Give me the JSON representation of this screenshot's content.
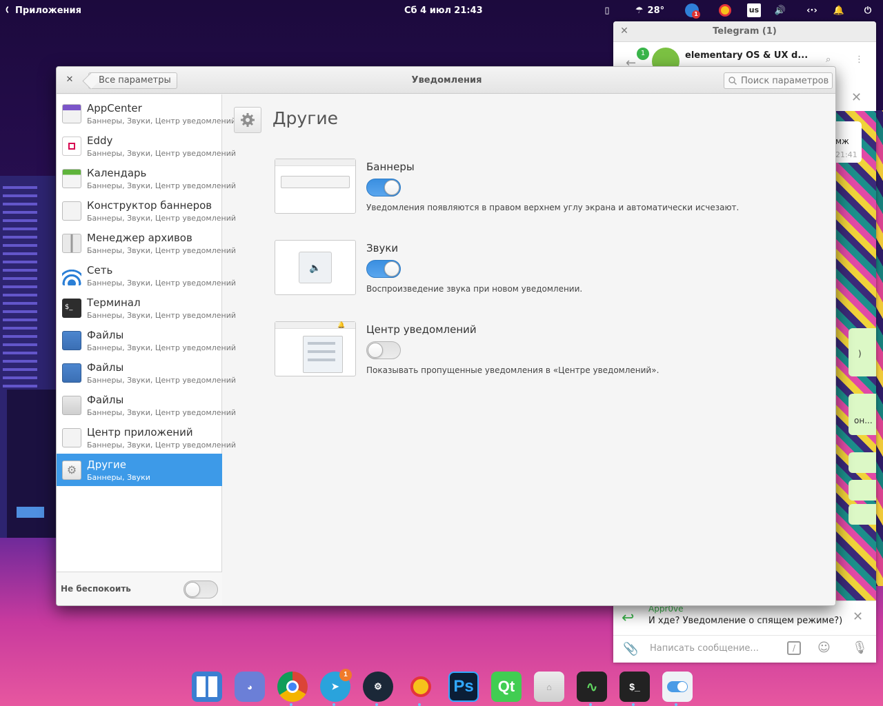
{
  "top_panel": {
    "apps_label": "Приложения",
    "date": "Сб  4 июл",
    "time": "21:43",
    "weather_temp": "28°",
    "keyboard_layout": "us",
    "tray_badge": "1"
  },
  "telegram": {
    "title": "Telegram (1)",
    "chat_name": "elementary OS & UX d...",
    "unread_badge": "1",
    "preview_snip": "мж",
    "preview_time": "21:41",
    "snip_2": ")",
    "snip_3": "он...",
    "notif_sender": "Appr0ve",
    "notif_text": "И хде? Уведомление о спящем режиме?)",
    "input_placeholder": "Написать сообщение..."
  },
  "settings": {
    "back_label": "Все параметры",
    "window_title": "Уведомления",
    "search_placeholder": "Поиск параметров",
    "sidebar": {
      "items": [
        {
          "name": "AppCenter",
          "sub": "Баннеры, Звуки, Центр уведомлений",
          "icon": "appcenter-icon"
        },
        {
          "name": "Eddy",
          "sub": "Баннеры, Звуки, Центр уведомлений",
          "icon": "eddy-icon"
        },
        {
          "name": "Календарь",
          "sub": "Баннеры, Звуки, Центр уведомлений",
          "icon": "calendar-icon"
        },
        {
          "name": "Конструктор баннеров",
          "sub": "Баннеры, Звуки, Центр уведомлений",
          "icon": "bag-icon"
        },
        {
          "name": "Менеджер архивов",
          "sub": "Баннеры, Звуки, Центр уведомлений",
          "icon": "archive-icon"
        },
        {
          "name": "Сеть",
          "sub": "Баннеры, Звуки, Центр уведомлений",
          "icon": "wifi-icon"
        },
        {
          "name": "Терминал",
          "sub": "Баннеры, Звуки, Центр уведомлений",
          "icon": "terminal-icon"
        },
        {
          "name": "Файлы",
          "sub": "Баннеры, Звуки, Центр уведомлений",
          "icon": "files-icon"
        },
        {
          "name": "Файлы",
          "sub": "Баннеры, Звуки, Центр уведомлений",
          "icon": "files-icon"
        },
        {
          "name": "Файлы",
          "sub": "Баннеры, Звуки, Центр уведомлений",
          "icon": "folder-home-icon"
        },
        {
          "name": "Центр приложений",
          "sub": "Баннеры, Звуки, Центр уведомлений",
          "icon": "bag-icon"
        },
        {
          "name": "Другие",
          "sub": "Баннеры, Звуки",
          "icon": "gear-icon",
          "selected": true
        }
      ],
      "dnd_label": "Не беспокоить",
      "dnd_on": false
    },
    "content": {
      "title": "Другие",
      "options": [
        {
          "title": "Баннеры",
          "desc": "Уведомления появляются в правом верхнем углу экрана и автоматически исчезают.",
          "on": true
        },
        {
          "title": "Звуки",
          "desc": "Воспроизведение звука при новом уведомлении.",
          "on": true
        },
        {
          "title": "Центр уведомлений",
          "desc": "Показывать пропущенные уведомления в «Центре уведомлений».",
          "on": false
        }
      ]
    }
  },
  "dock": {
    "items": [
      "multitasking-icon",
      "discord-icon",
      "chrome-icon",
      "telegram-icon",
      "steam-icon",
      "yandex-music-icon",
      "photoshop-icon",
      "qt-creator-icon",
      "files-icon",
      "system-monitor-icon",
      "terminal-icon",
      "settings-icon"
    ],
    "telegram_badge": "1",
    "ps_label": "Ps",
    "qt_label": "Qt",
    "term_label": "$_"
  },
  "colors": {
    "accent": "#3d9ae8",
    "toggle_on": "#4a9be6"
  }
}
